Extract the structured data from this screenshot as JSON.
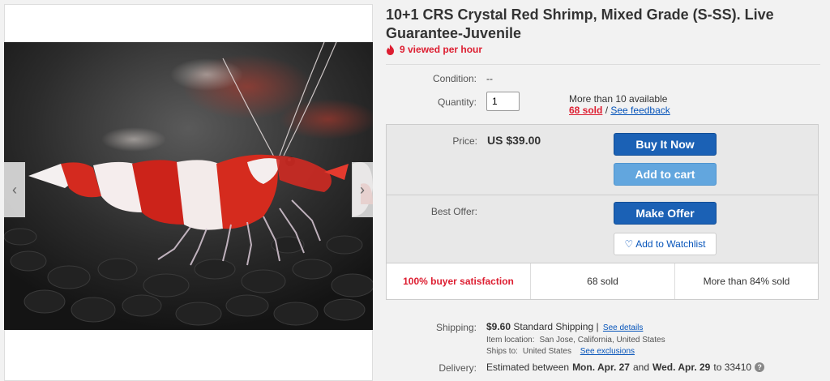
{
  "title": "10+1 CRS Crystal Red Shrimp, Mixed Grade (S-SS). Live Guarantee-Juvenile",
  "views": "9 viewed per hour",
  "icons": {
    "views": "flame-icon",
    "prev": "chevron-left-icon",
    "next": "chevron-right-icon",
    "watch": "heart-icon",
    "help": "question-icon"
  },
  "condition": {
    "label": "Condition:",
    "value": "--"
  },
  "quantity": {
    "label": "Quantity:",
    "value": "1",
    "available": "More than 10 available",
    "sold": "68 sold",
    "separator": " / ",
    "feedback": "See feedback"
  },
  "price": {
    "label": "Price:",
    "value": "US $39.00",
    "buy_now": "Buy It Now",
    "add_to_cart": "Add to cart"
  },
  "offer": {
    "label": "Best Offer:",
    "make_offer": "Make Offer",
    "watchlist": "Add to Watchlist"
  },
  "stats": {
    "satisfaction": "100% buyer satisfaction",
    "sold": "68 sold",
    "percent_sold": "More than 84% sold"
  },
  "shipping": {
    "label": "Shipping:",
    "cost": "$9.60",
    "method": "Standard Shipping |",
    "details": "See details",
    "location_label": "Item location:",
    "location": "San Jose, California, United States",
    "ships_to_label": "Ships to:",
    "ships_to": "United States",
    "exclusions": "See exclusions"
  },
  "delivery": {
    "label": "Delivery:",
    "prefix": "Estimated between",
    "start": "Mon. Apr. 27",
    "and": "and",
    "end": "Wed. Apr. 29",
    "to": "to 33410",
    "help": "?"
  },
  "colors": {
    "accent_red": "#dd1e31",
    "primary_blue": "#1b61b5",
    "light_blue": "#62a6de",
    "link_blue": "#0654ba"
  }
}
